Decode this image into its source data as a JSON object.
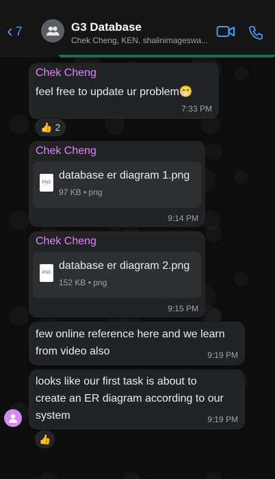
{
  "header": {
    "back_count": "7",
    "group_name": "G3 Database",
    "members": "Chek Cheng, KEN, shalinimageswa..."
  },
  "messages": [
    {
      "sender": "Chek Cheng",
      "text": "feel free to update ur problem😁",
      "time": "7:33 PM",
      "reaction": {
        "emoji": "👍",
        "count": "2"
      }
    },
    {
      "sender": "Chek Cheng",
      "file": {
        "name": "database er diagram 1.png",
        "meta": "97 KB • png",
        "type": "PNG"
      },
      "time": "9:14 PM"
    },
    {
      "sender": "Chek Cheng",
      "file": {
        "name": "database er diagram 2.png",
        "meta": "152 KB • png",
        "type": "PNG"
      },
      "time": "9:15 PM"
    },
    {
      "text_lines": [
        "few online reference here and we learn",
        "from video also"
      ],
      "time": "9:19 PM"
    },
    {
      "text_lines": [
        "looks like our first task is about to",
        "create an ER diagram according to our",
        "system"
      ],
      "time": "9:19 PM",
      "reaction": {
        "emoji": "👍"
      }
    }
  ],
  "icons": {
    "back": "chevron-left-icon",
    "group_avatar": "group-icon",
    "video": "video-camera-icon",
    "call": "phone-icon",
    "file": "png-file-icon",
    "user": "user-avatar-icon"
  },
  "colors": {
    "accent": "#3aa0ff",
    "sender": "#e481ff",
    "bubble": "#222324",
    "status_line": "#1d6b5a"
  }
}
